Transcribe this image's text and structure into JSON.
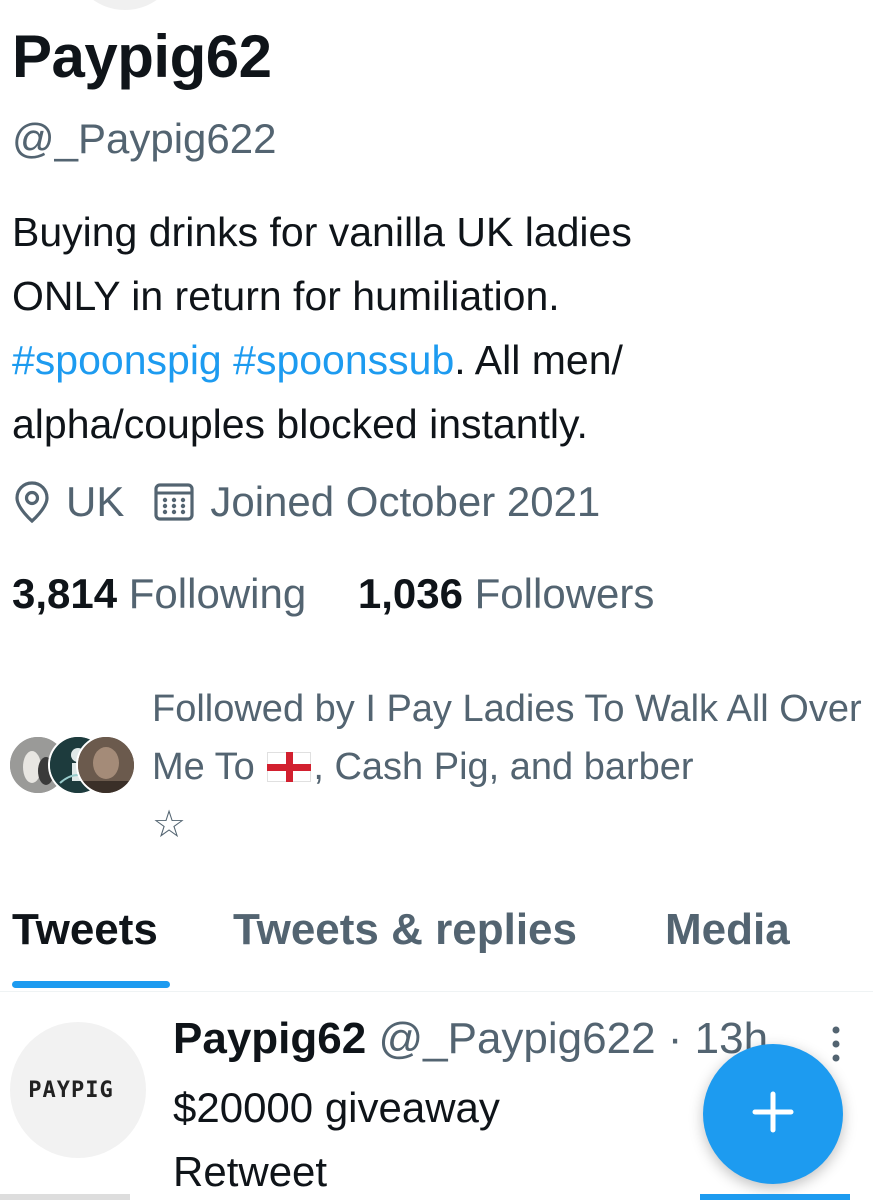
{
  "profile": {
    "display_name": "Paypig62",
    "handle": "@_Paypig622",
    "bio": {
      "line1": "Buying drinks for vanilla UK ladies",
      "line2": "ONLY in return for humiliation.",
      "hashtag1": "#spoonspig",
      "hashtag2": "#spoonssub",
      "line3_rest": ". All men/",
      "line4": "alpha/couples blocked instantly."
    },
    "location": "UK",
    "joined": "Joined October 2021",
    "following_count": "3,814",
    "following_label": "Following",
    "followers_count": "1,036",
    "followers_label": "Followers",
    "followed_by": {
      "prefix": "Followed by I Pay Ladies To Walk All Over Me To",
      "suffix": ", Cash Pig, and barber",
      "last": "☆"
    }
  },
  "tabs": [
    {
      "label": "Tweets",
      "active": true
    },
    {
      "label": "Tweets & replies",
      "active": false
    },
    {
      "label": "Media",
      "active": false
    }
  ],
  "tweet": {
    "name": "Paypig62",
    "handle": "@_Paypig622",
    "time": "· 13h",
    "line1": "$20000 giveaway",
    "line2": "Retweet",
    "avatar_text": "PAYPIG"
  },
  "icons": {
    "location": "location-pin-icon",
    "calendar": "calendar-icon",
    "more": "more-vertical-icon",
    "compose": "plus-icon"
  },
  "colors": {
    "accent": "#1d9bf0",
    "text": "#0f1419",
    "secondary": "#536471"
  }
}
